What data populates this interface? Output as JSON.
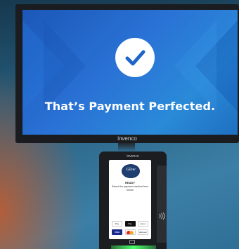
{
  "monitor": {
    "headline": "That’s Payment Perfected.",
    "brand": "invenco"
  },
  "terminal": {
    "brand": "invenco",
    "logo_text": "Glow",
    "status": "READY",
    "message": "Select the payment method from below",
    "payment_methods_row1": [
      "Pay",
      "Pay",
      "Amex"
    ],
    "payment_methods_row2": [
      "VISA",
      "",
      "discover"
    ]
  },
  "colors": {
    "screen_blue": "#2a73d6",
    "check_circle": "#ffffff",
    "check_mark": "#1f66c9",
    "status_light": "#4cff6a"
  },
  "icons": {
    "check": "checkmark-icon",
    "contactless": "contactless-icon",
    "mastercard": "mastercard-icon"
  }
}
